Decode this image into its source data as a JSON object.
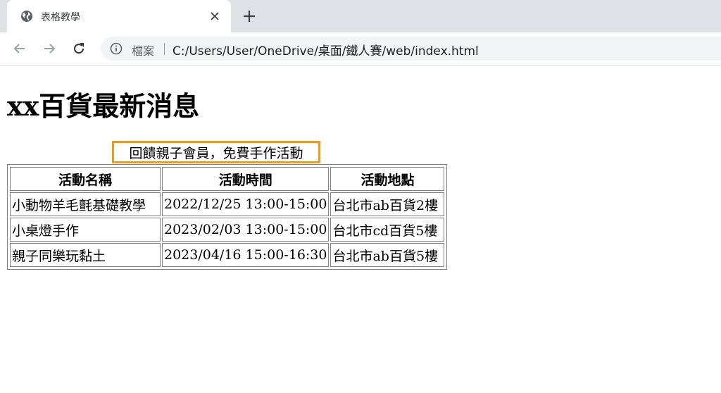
{
  "browser": {
    "tab_title": "表格教學",
    "omnibox_label": "檔案",
    "url": "C:/Users/User/OneDrive/桌面/鐵人賽/web/index.html"
  },
  "page": {
    "title": "xx百貨最新消息",
    "table": {
      "caption": "回饋親子會員，免費手作活動",
      "headers": [
        "活動名稱",
        "活動時間",
        "活動地點"
      ],
      "rows": [
        [
          "小動物羊毛氈基礎教學",
          "2022/12/25 13:00-15:00",
          "台北市ab百貨2樓"
        ],
        [
          "小桌燈手作",
          "2023/02/03 13:00-15:00",
          "台北市cd百貨5樓"
        ],
        [
          "親子同樂玩黏土",
          "2023/04/16 15:00-16:30",
          "台北市ab百貨5樓"
        ]
      ]
    }
  },
  "colors": {
    "caption_highlight": "#f29a17",
    "tabstrip_background": "#dee1e6",
    "omnibox_background": "#f1f3f4"
  },
  "icons": [
    "globe-icon",
    "close-icon",
    "plus-icon",
    "back-arrow-icon",
    "forward-arrow-icon",
    "reload-icon",
    "info-icon"
  ]
}
